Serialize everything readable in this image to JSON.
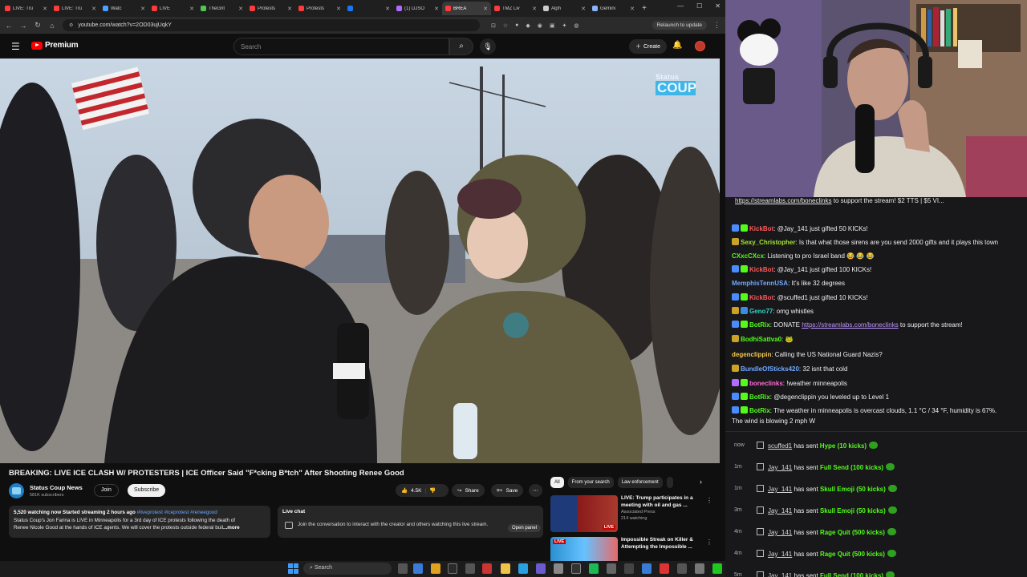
{
  "browser": {
    "tabs": [
      {
        "label": "LIVE: Tru",
        "color": "#ff3b3b"
      },
      {
        "label": "LIVE: Tru",
        "color": "#ff3b3b"
      },
      {
        "label": "Watc",
        "color": "#4aa3ff"
      },
      {
        "label": "LIVE",
        "color": "#ff3b3b"
      },
      {
        "label": "TheGrit",
        "color": "#53c653"
      },
      {
        "label": "Protests",
        "color": "#ff3b3b"
      },
      {
        "label": "Protests",
        "color": "#ff3b3b"
      },
      {
        "label": "",
        "color": "#1877f2"
      },
      {
        "label": "(1) DJSO",
        "color": "#b06cff"
      },
      {
        "label": "BREA",
        "color": "#ff3b3b"
      },
      {
        "label": "TMZ Liv",
        "color": "#ff3b3b"
      },
      {
        "label": "Alph",
        "color": "#cccccc"
      },
      {
        "label": "Gemini",
        "color": "#8ab4f8"
      }
    ],
    "url": "youtube.com/watch?v=2OD03ujUqkY",
    "relaunch_label": "Relaunch to update"
  },
  "youtube": {
    "logo_text": "Premium",
    "search_placeholder": "Search",
    "create_label": "Create",
    "video_watermark": {
      "line1": "Status",
      "line2": "COUP"
    },
    "title": "BREAKING: LIVE ICE CLASH W/ PROTESTERS | ICE Officer Said \"F*cking B*tch\" After Shooting Renee Good",
    "channel_name": "Status Coup News",
    "channel_subs": "581K subscribers",
    "join_label": "Join",
    "subscribe_label": "Subscribe",
    "like_count": "4.5K",
    "share_label": "Share",
    "save_label": "Save",
    "description": {
      "meta": "5,520 watching now  Started streaming 2 hours ago",
      "tags": "#liveprotest #iceprotest #reneegood",
      "line2": "Status Coup's Jon Farina is LIVE in Minneapolis for a 3rd day of ICE protests following the death of",
      "line3": "Renee Nicole Good at the hands of ICE agents. We will cover the protests outside federal buil",
      "more": "...more"
    },
    "live_chat": {
      "title": "Live chat",
      "desc": "Join the conversation to interact with the creator and others watching this live stream.",
      "open_label": "Open panel"
    },
    "chips": [
      "All",
      "From your search",
      "Law enforcement"
    ],
    "recommendations": [
      {
        "title": "LIVE: Trump participates in a meeting with oil and gas ...",
        "channel": "Associated Press",
        "views": "214 watching",
        "thumb_tag": "LIVE"
      },
      {
        "title": "Impossible Streak on Killer & Attempting the Impossible ...",
        "channel": "",
        "views": "",
        "thumb_tag": "LIVE"
      }
    ]
  },
  "stream_banner": {
    "link": "https://streamlabs.com/boneclinks",
    "text": " to support the stream! $2 TTS | $5 VI..."
  },
  "chat": [
    {
      "user": "KickBot",
      "text": "@Jay_141 just gifted 50 KICKs!",
      "color": "#ff5a5a",
      "badges": [
        "#4a8cff",
        "#53fc18"
      ]
    },
    {
      "user": "Sexy_Christopher",
      "text": "Is that what those sirens are you send 2000 gifts and it plays this town",
      "color": "#a3e635",
      "badges": [
        "#c9a227"
      ]
    },
    {
      "user": "CXxcCXcx",
      "text": "Listening to pro Israel band 😂 😂 😂",
      "color": "#53fc18",
      "badges": []
    },
    {
      "user": "KickBot",
      "text": "@Jay_141 just gifted 100 KICKs!",
      "color": "#ff5a5a",
      "badges": [
        "#4a8cff",
        "#53fc18"
      ]
    },
    {
      "user": "MemphisTennUSA",
      "text": "It's like 32 degrees",
      "color": "#6fa8ff",
      "badges": []
    },
    {
      "user": "KickBot",
      "text": "@scuffed1 just gifted 10 KICKs!",
      "color": "#ff5a5a",
      "badges": [
        "#4a8cff",
        "#53fc18"
      ]
    },
    {
      "user": "Geno77",
      "text": "omg whistles",
      "color": "#33d1c4",
      "badges": [
        "#c9a227",
        "#3a8dde"
      ]
    },
    {
      "user": "BotRix",
      "text": "DONATE ",
      "link": "https://streamlabs.com/boneclinks",
      "after": " to support the stream!",
      "color": "#53fc18",
      "badges": [
        "#4a8cff",
        "#53fc18"
      ]
    },
    {
      "user": "BodhiSattva0",
      "text": "🐸",
      "color": "#53fc18",
      "badges": [
        "#c9a227"
      ]
    },
    {
      "user": "degenclippin",
      "text": "Calling the US National Guard Nazis?",
      "color": "#f2c94c",
      "badges": []
    },
    {
      "user": "BundleOfSticks420",
      "text": "32 isnt that cold",
      "color": "#6fa8ff",
      "badges": [
        "#c9a227"
      ]
    },
    {
      "user": "boneclinks",
      "text": "!weather minneapolis",
      "color": "#ff6ad5",
      "badges": [
        "#b06cff",
        "#53fc18"
      ]
    },
    {
      "user": "BotRix",
      "text": "@degenclippin you leveled up to Level 1",
      "color": "#53fc18",
      "badges": [
        "#4a8cff",
        "#53fc18"
      ]
    },
    {
      "user": "BotRix",
      "text": "The weather in minneapolis is overcast clouds, 1.1 °C / 34 °F, humidity is 67%.",
      "color": "#53fc18",
      "badges": [
        "#4a8cff",
        "#53fc18"
      ]
    },
    {
      "user": "",
      "text": "The wind is blowing 2 mph W",
      "color": "#efeff1",
      "badges": []
    }
  ],
  "events": [
    {
      "time": "now",
      "user": "scuffed1",
      "gift": "Hype (10 kicks)"
    },
    {
      "time": "1m",
      "user": "Jay_141",
      "gift": "Full Send (100 kicks)"
    },
    {
      "time": "1m",
      "user": "Jay_141",
      "gift": "Skull Emoji (50 kicks)"
    },
    {
      "time": "3m",
      "user": "Jay_141",
      "gift": "Skull Emoji (50 kicks)"
    },
    {
      "time": "4m",
      "user": "Jay_141",
      "gift": "Rage Quit (500 kicks)"
    },
    {
      "time": "4m",
      "user": "Jay_141",
      "gift": "Rage Quit (500 kicks)"
    },
    {
      "time": "5m",
      "user": "Jay_141",
      "gift": "Full Send (100 kicks)"
    }
  ],
  "events_mid": " has sent ",
  "taskbar": {
    "search_label": "Search"
  }
}
